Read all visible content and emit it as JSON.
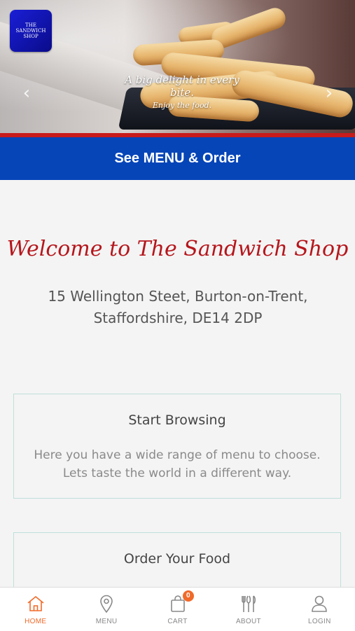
{
  "hero": {
    "logo_text": "THE SANDWICH SHOP",
    "tagline_main": "A big delight in every bite.",
    "tagline_sub": "Enjoy the food.",
    "prev_arrow": "‹",
    "next_arrow": "›"
  },
  "cta": {
    "label": "See MENU & Order"
  },
  "main": {
    "welcome": "Welcome to The Sandwich Shop",
    "address": "15 Wellington Steet, Burton-on-Trent, Staffordshire, DE14 2DP",
    "cards": [
      {
        "title": "Start Browsing",
        "text": "Here you have a wide range of menu to choose. Lets taste the world in a different way."
      },
      {
        "title": "Order Your Food",
        "text": ""
      }
    ]
  },
  "tabbar": {
    "items": [
      {
        "label": "HOME",
        "icon": "home-icon",
        "active": true
      },
      {
        "label": "MENU",
        "icon": "map-pin-icon"
      },
      {
        "label": "CART",
        "icon": "shopping-bag-icon",
        "badge": "0"
      },
      {
        "label": "ABOUT",
        "icon": "cutlery-icon"
      },
      {
        "label": "LOGIN",
        "icon": "user-icon"
      }
    ]
  },
  "colors": {
    "cta_blue": "#0645b8",
    "accent_red": "#c81b1b",
    "welcome_red": "#b5161c",
    "active_orange": "#f06a2a",
    "card_border": "#bfe0da"
  }
}
